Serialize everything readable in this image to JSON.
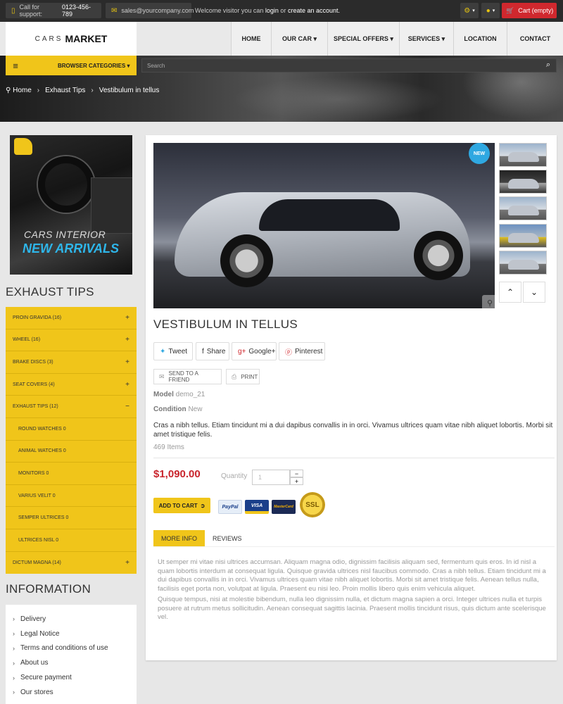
{
  "topbar": {
    "support_label": "Call for support:",
    "support_phone": "0123-456-789",
    "email": "sales@yourcompany.com",
    "welcome_prefix": "Welcome visitor you can",
    "login": "login",
    "or": "or",
    "create_account": "create an account.",
    "cart": "Cart (empty)"
  },
  "logo": {
    "cars": "CARS",
    "market": "MARKET"
  },
  "nav": [
    "HOME",
    "OUR CAR",
    "SPECIAL OFFERS",
    "SERVICES",
    "LOCATION",
    "CONTACT"
  ],
  "categories_button": "BROWSER CATEGORIES",
  "search": {
    "placeholder": "Search"
  },
  "breadcrumb": {
    "home": "Home",
    "level1": "Exhaust Tips",
    "level2": "Vestibulum in tellus"
  },
  "banner": {
    "line1": "CARS INTERIOR",
    "line2": "NEW ARRIVALS"
  },
  "sidebar": {
    "exhaust_title": "EXHAUST TIPS",
    "categories": [
      {
        "label": "PROIN GRAVIDA (16)",
        "icon": "+"
      },
      {
        "label": "WHEEL (16)",
        "icon": "+"
      },
      {
        "label": "BRAKE DISCS (3)",
        "icon": "+"
      },
      {
        "label": "SEAT COVERS (4)",
        "icon": "+"
      },
      {
        "label": "EXHAUST TIPS (12)",
        "icon": "−"
      },
      {
        "label": "ROUND WATCHES 0",
        "icon": ""
      },
      {
        "label": "ANIMAL WATCHES 0",
        "icon": ""
      },
      {
        "label": "MONITORS 0",
        "icon": ""
      },
      {
        "label": "VARIUS VELIT 0",
        "icon": ""
      },
      {
        "label": "SEMPER ULTRICES 0",
        "icon": ""
      },
      {
        "label": "ULTRICES NISL 0",
        "icon": ""
      },
      {
        "label": "DICTUM MAGNA (14)",
        "icon": "+"
      }
    ],
    "information_title": "INFORMATION",
    "information": [
      "Delivery",
      "Legal Notice",
      "Terms and conditions of use",
      "About us",
      "Secure payment",
      "Our stores"
    ]
  },
  "product": {
    "badge": "NEW",
    "title": "VESTIBULUM IN TELLUS",
    "social": {
      "tweet": "Tweet",
      "share": "Share",
      "google": "Google+",
      "pinterest": "Pinterest"
    },
    "send_friend": "SEND TO A FRIEND",
    "print": "PRINT",
    "model_label": "Model",
    "model_value": "demo_21",
    "condition_label": "Condition",
    "condition_value": "New",
    "description": "Cras a nibh tellus. Etiam tincidunt mi a dui dapibus convallis in in orci. Vivamus ultrices quam vitae nibh aliquet lobortis. Morbi sit amet tristique felis.",
    "items": "469 Items",
    "price": "$1,090.00",
    "quantity_label": "Quantity",
    "quantity_value": "1",
    "add_to_cart": "ADD TO CART",
    "payment": {
      "paypal": "PayPal",
      "visa": "VISA",
      "mastercard": "MasterCard",
      "ssl": "SSL"
    },
    "tabs": [
      "MORE INFO",
      "REVIEWS"
    ],
    "more_info": [
      "Ut semper mi vitae nisi ultrices accumsan. Aliquam magna odio, dignissim facilisis aliquam sed, fermentum quis eros. In id nisl a quam lobortis interdum at consequat ligula. Quisque gravida ultrices nisl faucibus commodo. Cras a nibh tellus. Etiam tincidunt mi a dui dapibus convallis in in orci. Vivamus ultrices quam vitae nibh aliquet lobortis. Morbi sit amet tristique felis. Aenean tellus nulla, facilisis eget porta non, volutpat at ligula. Praesent eu nisi leo. Proin mollis libero quis enim vehicula aliquet.",
      "Quisque tempus, nisi at molestie bibendum, nulla leo dignissim nulla, et dictum magna sapien a orci. Integer ultrices nulla et turpis posuere at rutrum metus sollicitudin. Aenean consequat sagittis lacinia. Praesent mollis tincidunt risus, quis dictum ante scelerisque vel."
    ]
  },
  "colors": {
    "accent": "#f0c51a",
    "price": "#c9252d",
    "badge": "#2fa8e1",
    "cart": "#d0282e"
  }
}
